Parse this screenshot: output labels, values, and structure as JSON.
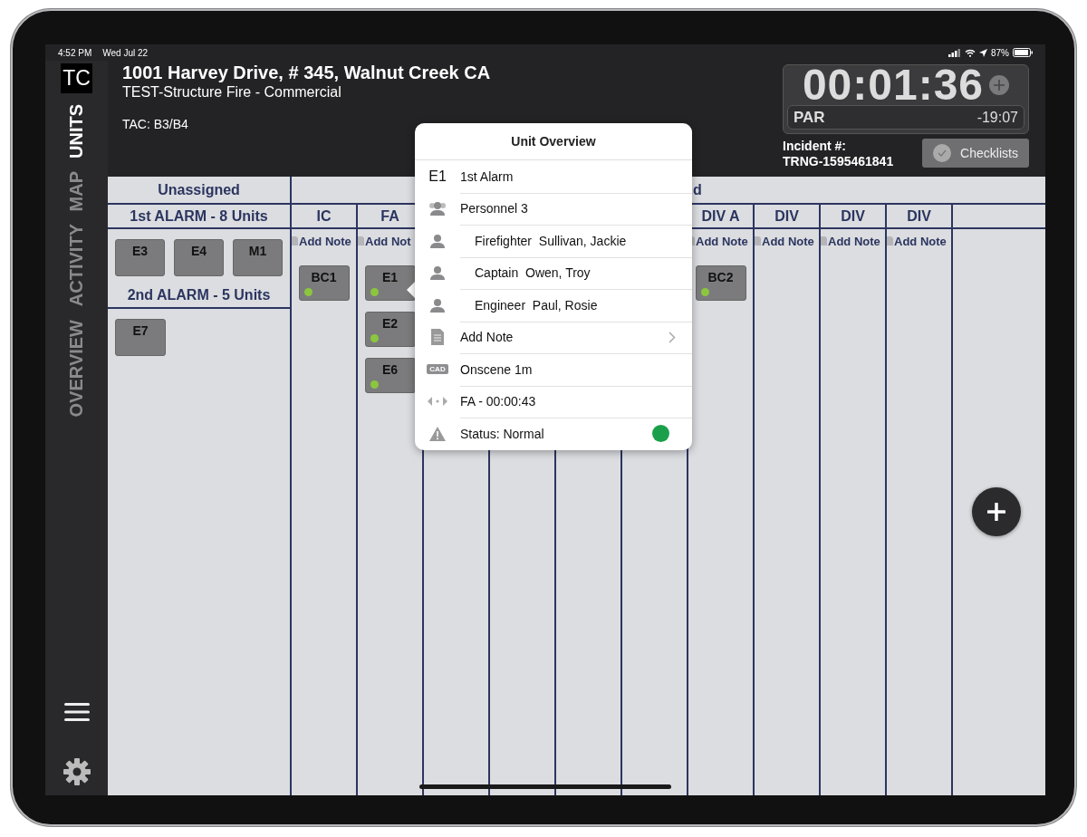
{
  "status_bar": {
    "time": "4:52 PM",
    "date": "Wed Jul 22",
    "battery": "87%"
  },
  "sidebar": {
    "logo": "TC",
    "tabs": [
      {
        "label": "UNITS",
        "selected": true
      },
      {
        "label": "MAP",
        "selected": false
      },
      {
        "label": "ACTIVITY",
        "selected": false
      },
      {
        "label": "OVERVIEW",
        "selected": false
      }
    ]
  },
  "incident": {
    "address": "1001 Harvey Drive, # 345, Walnut Creek CA",
    "type": "TEST-Structure Fire - Commercial",
    "tac": "TAC: B3/B4",
    "number_label": "Incident #:",
    "number": "TRNG-1595461841"
  },
  "timer": {
    "elapsed": "00:01:36",
    "par_label": "PAR",
    "par_time": "-19:07"
  },
  "checklists_button": "Checklists",
  "board": {
    "unassigned": {
      "title": "Unassigned",
      "groups": [
        {
          "title": "1st ALARM - 8 Units",
          "units": [
            {
              "label": "E3"
            },
            {
              "label": "E4"
            },
            {
              "label": "M1"
            }
          ]
        },
        {
          "title": "2nd ALARM - 5 Units",
          "units": [
            {
              "label": "E7"
            }
          ]
        }
      ]
    },
    "assigned": {
      "title": "d",
      "columns": [
        {
          "label": "IC",
          "note": "Add Note",
          "units": [
            {
              "label": "BC1",
              "color": "#8cc63f"
            }
          ]
        },
        {
          "label": "FA",
          "note": "Add Not",
          "units": [
            {
              "label": "E1",
              "color": "#8cc63f"
            },
            {
              "label": "E2",
              "color": "#8cc63f"
            },
            {
              "label": "E6",
              "color": "#8cc63f"
            }
          ]
        },
        {},
        {},
        {},
        {},
        {
          "label": "DIV A",
          "note": "Add Note",
          "units": [
            {
              "label": "BC2",
              "color": "#8cc63f"
            }
          ]
        },
        {
          "label": "DIV",
          "note": "Add Note"
        },
        {
          "label": "DIV",
          "note": "Add Note"
        },
        {
          "label": "DIV",
          "note": "Add Note"
        },
        {}
      ]
    }
  },
  "popover": {
    "title": "Unit Overview",
    "rows": [
      {
        "kind": "unit",
        "unit": "E1",
        "text": "1st Alarm"
      },
      {
        "kind": "personnel",
        "text": "Personnel 3"
      },
      {
        "kind": "person",
        "role": "Firefighter",
        "name": "Sullivan, Jackie"
      },
      {
        "kind": "person",
        "role": "Captain",
        "name": "Owen, Troy"
      },
      {
        "kind": "person",
        "role": "Engineer",
        "name": "Paul, Rosie"
      },
      {
        "kind": "note",
        "text": "Add Note"
      },
      {
        "kind": "cad",
        "badge": "CAD",
        "text": "Onscene 1m"
      },
      {
        "kind": "assignment",
        "text": "FA - 00:00:43"
      },
      {
        "kind": "status",
        "text": "Status: Normal",
        "color": "#1aa04a"
      }
    ]
  }
}
